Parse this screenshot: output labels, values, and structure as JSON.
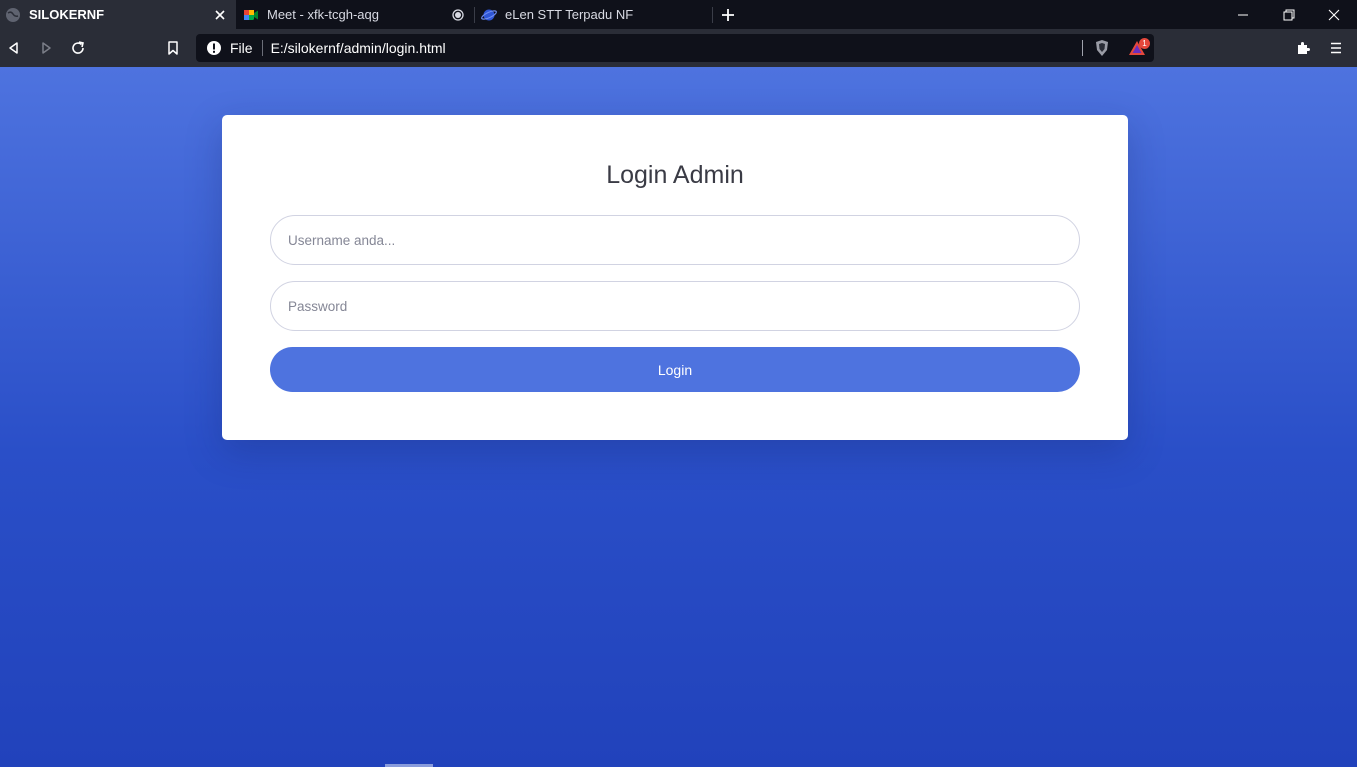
{
  "browser": {
    "tabs": [
      {
        "title": "SILOKERNF",
        "active": true
      },
      {
        "title": "Meet - xfk-tcgh-aqg",
        "active": false
      },
      {
        "title": "eLen STT Terpadu NF",
        "active": false
      }
    ],
    "toolbar": {
      "url_scheme": "File",
      "url": "E:/silokernf/admin/login.html",
      "rewards_badge": "1"
    }
  },
  "login": {
    "heading": "Login Admin",
    "username_placeholder": "Username anda...",
    "password_placeholder": "Password",
    "button_label": "Login"
  },
  "colors": {
    "primary": "#4e73df",
    "page_bg_top": "#4e73df",
    "page_bg_bottom": "#2142bb",
    "chrome_dark": "#0f111a",
    "chrome_toolbar": "#2a2d37"
  }
}
